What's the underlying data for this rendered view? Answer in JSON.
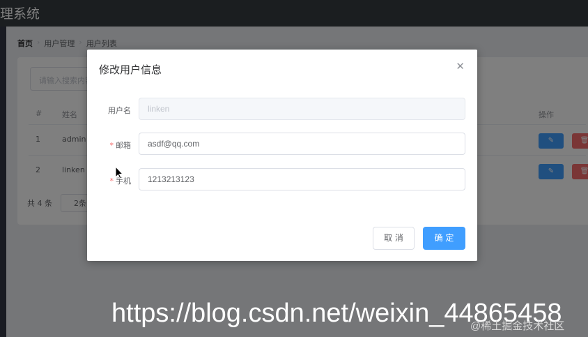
{
  "header": {
    "title": "理系统"
  },
  "breadcrumb": [
    "首页",
    "用户管理",
    "用户列表"
  ],
  "search": {
    "placeholder": "请输入搜索内容"
  },
  "table": {
    "columns": [
      "#",
      "姓名",
      "操作"
    ],
    "rows": [
      {
        "index": "1",
        "name": "admin"
      },
      {
        "index": "2",
        "name": "linken"
      }
    ]
  },
  "pager": {
    "total": "共 4 条",
    "size": "2条"
  },
  "dialog": {
    "title": "修改用户信息",
    "close_icon": "close-icon",
    "fields": [
      {
        "label": "用户名",
        "value": "linken",
        "required": false,
        "disabled": true
      },
      {
        "label": "邮箱",
        "value": "asdf@qq.com",
        "required": true,
        "disabled": false
      },
      {
        "label": "手机",
        "value": "1213213123",
        "required": true,
        "disabled": false
      }
    ],
    "cancel_label": "取 消",
    "ok_label": "确 定"
  },
  "watermark": {
    "url": "https://blog.csdn.net/weixin_44865458",
    "sub": "@稀土掘金技术社区"
  },
  "colors": {
    "primary": "#409eff",
    "danger": "#f56c6c",
    "required": "#f56c6c"
  }
}
